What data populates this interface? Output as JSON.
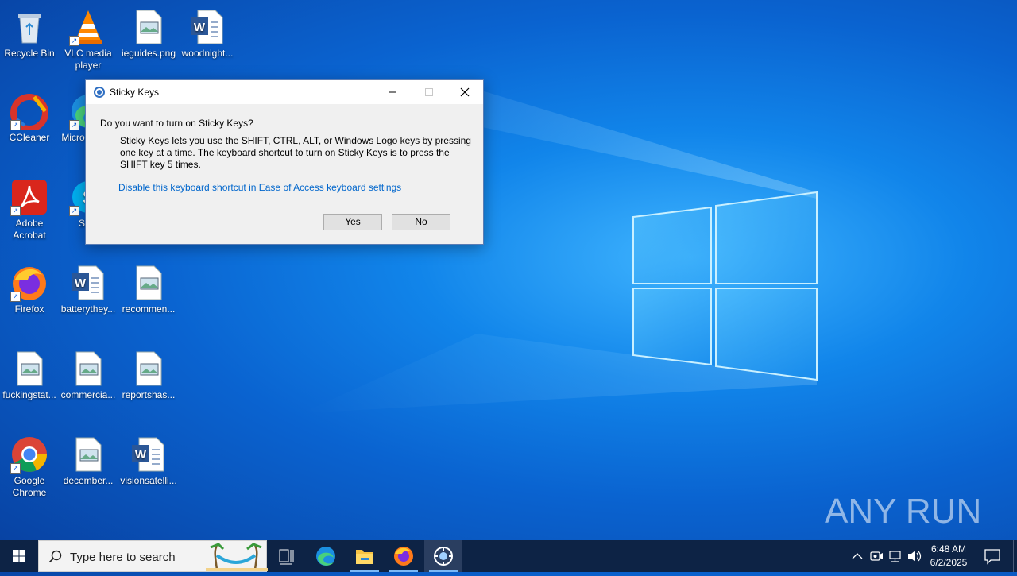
{
  "desktop_icons": [
    {
      "label": "Recycle Bin",
      "icon": "recycle-bin-icon"
    },
    {
      "label": "VLC media player",
      "icon": "vlc-icon"
    },
    {
      "label": "ieguides.png",
      "icon": "image-file-icon"
    },
    {
      "label": "woodnight...",
      "icon": "word-doc-icon"
    },
    {
      "label": "CCleaner",
      "icon": "ccleaner-icon"
    },
    {
      "label": "Micro... Ed...",
      "icon": "edge-icon"
    },
    {
      "label": "Adobe Acrobat",
      "icon": "acrobat-icon"
    },
    {
      "label": "Sk...",
      "icon": "skype-icon"
    },
    {
      "label": "Firefox",
      "icon": "firefox-icon"
    },
    {
      "label": "batterythey...",
      "icon": "word-doc-icon"
    },
    {
      "label": "recommen...",
      "icon": "image-file-icon"
    },
    {
      "label": "fuckingstat...",
      "icon": "image-file-icon"
    },
    {
      "label": "commercia...",
      "icon": "image-file-icon"
    },
    {
      "label": "reportshas...",
      "icon": "image-file-icon"
    },
    {
      "label": "Google Chrome",
      "icon": "chrome-icon"
    },
    {
      "label": "december...",
      "icon": "image-file-icon"
    },
    {
      "label": "visionsatelli...",
      "icon": "word-doc-icon"
    }
  ],
  "dialog": {
    "title": "Sticky Keys",
    "question": "Do you want to turn on Sticky Keys?",
    "body": "Sticky Keys lets you use the SHIFT, CTRL, ALT, or Windows Logo keys by pressing one key at a time. The keyboard shortcut to turn on Sticky Keys is to press the SHIFT key 5 times.",
    "link": "Disable this keyboard shortcut in Ease of Access keyboard settings",
    "yes_label": "Yes",
    "no_label": "No"
  },
  "taskbar": {
    "search_placeholder": "Type here to search",
    "time": "6:48 AM",
    "date": "6/2/2025",
    "pinned": [
      "task-view-icon",
      "edge-icon",
      "file-explorer-icon",
      "firefox-icon",
      "ease-of-access-icon"
    ]
  },
  "watermark": "ANY RUN",
  "colors": {
    "accent": "#0078d7",
    "link": "#0066cc",
    "taskbar": "#0d2345"
  }
}
